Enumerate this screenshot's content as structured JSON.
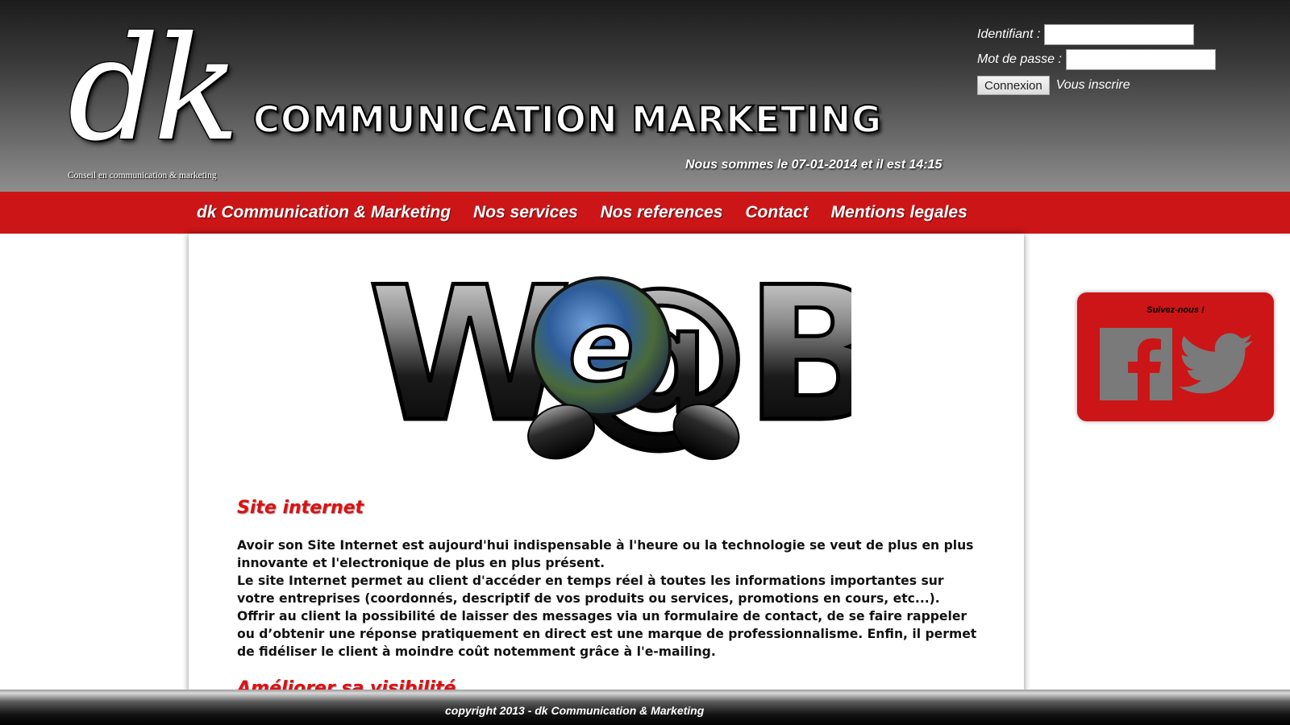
{
  "header": {
    "logo_letters": "dk",
    "logo_tagline": "Conseil en communication & marketing",
    "brand_title": "COMMUNICATION MARKETING",
    "date_line": "Nous sommes le 07-01-2014 et il est 14:15"
  },
  "login": {
    "username_label": "Identifiant :",
    "username_value": "",
    "password_label": "Mot de passe :",
    "password_value": "",
    "connect_label": "Connexion",
    "register_label": "Vous inscrire"
  },
  "nav": {
    "items": [
      {
        "label": "dk Communication & Marketing"
      },
      {
        "label": "Nos services"
      },
      {
        "label": "Nos references"
      },
      {
        "label": "Contact"
      },
      {
        "label": "Mentions legales"
      }
    ]
  },
  "main": {
    "hero_text": "W@B",
    "section1_title": "Site internet",
    "section1_paragraphs": [
      "Avoir son Site Internet est aujourd'hui indispensable à l'heure ou la technologie se veut de plus en plus innovante et l'electronique de plus en plus présent.",
      "Le site Internet permet au client d'accéder en temps réel à toutes les informations importantes sur votre entreprises (coordonnés, descriptif de vos produits ou services, promotions en cours, etc...).",
      "Offrir au client la possibilité de laisser des messages via un formulaire de contact, de se faire rappeler ou d’obtenir une réponse pratiquement en direct est une marque de professionnalisme. Enfin, il permet de fidéliser le client à moindre coût notemment grâce à l'e-mailing."
    ],
    "section2_title": "Améliorer sa visibilité"
  },
  "social": {
    "follow_label": "Suivez-nous !",
    "icons": [
      "facebook-icon",
      "twitter-icon"
    ]
  },
  "footer": {
    "copyright": "copyright 2013 - dk Communication & Marketing"
  },
  "colors": {
    "accent_red": "#cc1517",
    "title_red": "#e01010",
    "icon_gray": "#7a7a7a"
  }
}
